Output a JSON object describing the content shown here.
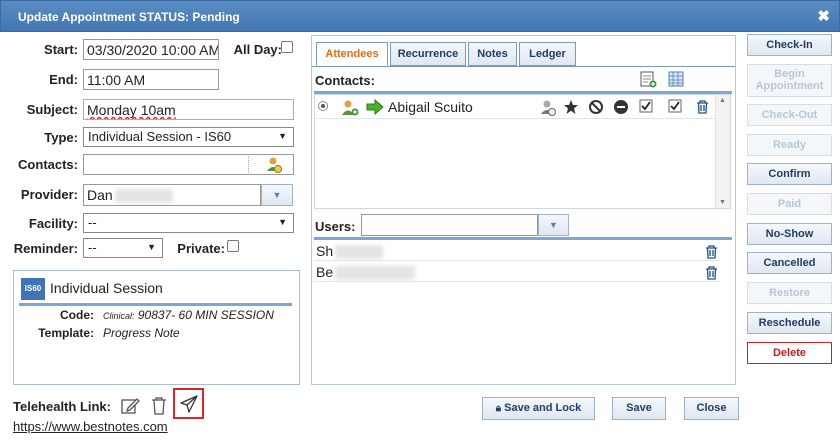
{
  "dialog": {
    "title": "Update Appointment STATUS: Pending",
    "close_label": "✖"
  },
  "form": {
    "start_label": "Start:",
    "start_value": "03/30/2020 10:00 AM",
    "allday_label": "All Day:",
    "end_label": "End:",
    "end_value": "11:00 AM",
    "subject_label": "Subject:",
    "subject_value": "Monday 10am",
    "type_label": "Type:",
    "type_value": "Individual Session - IS60",
    "contacts_label": "Contacts:",
    "provider_label": "Provider:",
    "provider_value": "Dan",
    "facility_label": "Facility:",
    "facility_value": "--",
    "reminder_label": "Reminder:",
    "reminder_value": "--",
    "private_label": "Private:"
  },
  "session": {
    "badge": "IS60",
    "name": "Individual Session",
    "code_label": "Code:",
    "code_prefix": "Clinical:",
    "code_value": "90837- 60 MIN SESSION",
    "template_label": "Template:",
    "template_value": "Progress Note"
  },
  "telehealth": {
    "label": "Telehealth Link:",
    "url": "https://www.bestnotes.com"
  },
  "tabs": [
    {
      "label": "Attendees"
    },
    {
      "label": "Recurrence"
    },
    {
      "label": "Notes"
    },
    {
      "label": "Ledger"
    }
  ],
  "attendees": {
    "contacts_header": "Contacts:",
    "contact_name": "Abigail Scuito",
    "users_label": "Users:",
    "users": [
      {
        "name": "Sh"
      },
      {
        "name": "Be"
      }
    ]
  },
  "side_buttons": [
    {
      "label": "Check-In",
      "enabled": true
    },
    {
      "label": "Begin Appointment",
      "enabled": false
    },
    {
      "label": "Check-Out",
      "enabled": false
    },
    {
      "label": "Ready",
      "enabled": false
    },
    {
      "label": "Confirm",
      "enabled": true
    },
    {
      "label": "Paid",
      "enabled": false
    },
    {
      "label": "No-Show",
      "enabled": true
    },
    {
      "label": "Cancelled",
      "enabled": true
    },
    {
      "label": "Restore",
      "enabled": false
    },
    {
      "label": "Reschedule",
      "enabled": true
    },
    {
      "label": "Delete",
      "enabled": true
    }
  ],
  "bottom": {
    "save_lock": "Save and Lock",
    "save": "Save",
    "close": "Close"
  },
  "colors": {
    "accent": "#4277b3",
    "active_tab": "#e26d11",
    "delete": "#c11d1d",
    "highlight_box": "#d9252a"
  }
}
